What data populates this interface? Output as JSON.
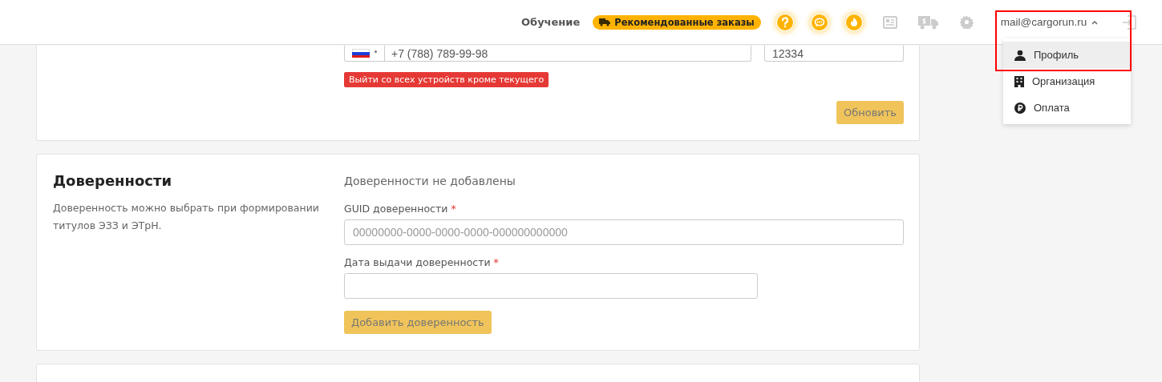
{
  "header": {
    "learn_link": "Обучение",
    "recommended_orders": "Рекомендованные заказы",
    "user_email": "mail@cargorun.ru",
    "menu_expanded": true
  },
  "user_menu": [
    {
      "label": "Профиль",
      "kind": "person",
      "selected": true
    },
    {
      "label": "Организация",
      "kind": "building",
      "selected": false
    },
    {
      "label": "Оплата",
      "kind": "ruble",
      "selected": false
    }
  ],
  "contact_card": {
    "phone": "+7 (788) 789-99-98",
    "code": "12334",
    "logout_all_button": "Выйти со всех устройств кроме текущего",
    "update_button": "Обновить"
  },
  "poa_card": {
    "title": "Доверенности",
    "description": "Доверенность можно выбрать при формировании титулов ЭЗЗ и ЭТрН.",
    "empty_message": "Доверенности не добавлены",
    "guid_label": "GUID доверенности",
    "guid_placeholder": "00000000-0000-0000-0000-000000000000",
    "date_label": "Дата выдачи доверенности",
    "required_mark": "*",
    "add_button": "Добавить доверенность"
  }
}
